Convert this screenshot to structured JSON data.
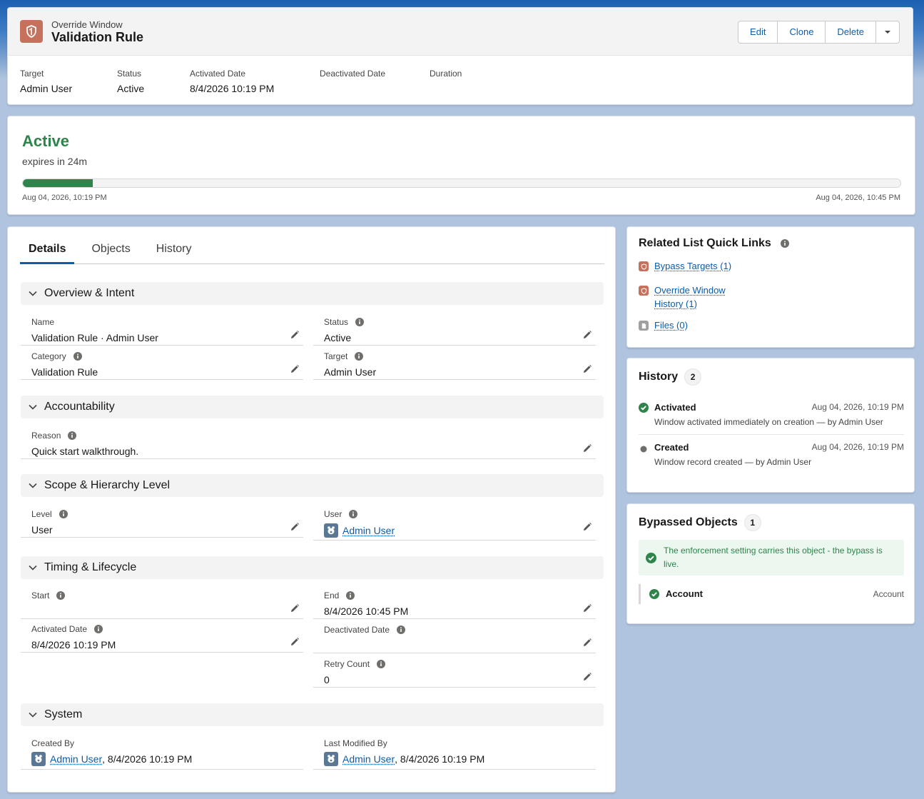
{
  "header": {
    "object_type": "Override Window",
    "title": "Validation Rule",
    "buttons": {
      "edit": "Edit",
      "clone": "Clone",
      "delete": "Delete"
    },
    "highlights": [
      {
        "label": "Target",
        "value": "Admin User"
      },
      {
        "label": "Status",
        "value": "Active"
      },
      {
        "label": "Activated Date",
        "value": "8/4/2026 10:19 PM"
      },
      {
        "label": "Deactivated Date",
        "value": ""
      },
      {
        "label": "Duration",
        "value": ""
      }
    ]
  },
  "status_card": {
    "title": "Active",
    "subtitle": "expires in 24m",
    "progress": 0.08,
    "start_label": "Aug 04, 2026, 10:19 PM",
    "end_label": "Aug 04, 2026, 10:45 PM"
  },
  "tabs": [
    {
      "label": "Details",
      "active": true
    },
    {
      "label": "Objects",
      "active": false
    },
    {
      "label": "History",
      "active": false
    }
  ],
  "sections": {
    "overview": {
      "title": "Overview & Intent",
      "name_label": "Name",
      "name_value": "Validation Rule · Admin User",
      "status_label": "Status",
      "status_value": "Active",
      "category_label": "Category",
      "category_value": "Validation Rule",
      "target_label": "Target",
      "target_value": "Admin User"
    },
    "accountability": {
      "title": "Accountability",
      "reason_label": "Reason",
      "reason_value": "Quick start walkthrough."
    },
    "scope": {
      "title": "Scope & Hierarchy Level",
      "level_label": "Level",
      "level_value": "User",
      "user_label": "User",
      "user_value": "Admin User"
    },
    "timing": {
      "title": "Timing & Lifecycle",
      "start_label": "Start",
      "start_value": "",
      "end_label": "End",
      "end_value": "8/4/2026 10:45 PM",
      "activated_label": "Activated Date",
      "activated_value": "8/4/2026 10:19 PM",
      "deactivated_label": "Deactivated Date",
      "deactivated_value": "",
      "retry_label": "Retry Count",
      "retry_value": "0"
    },
    "system": {
      "title": "System",
      "created_label": "Created By",
      "created_user": "Admin User",
      "created_date": ", 8/4/2026 10:19 PM",
      "modified_label": "Last Modified By",
      "modified_user": "Admin User",
      "modified_date": ", 8/4/2026 10:19 PM"
    }
  },
  "quick_links": {
    "title": "Related List Quick Links",
    "items": [
      {
        "label": "Bypass Targets (1)",
        "icon": "shield-icon"
      },
      {
        "label_line1": "Override Window",
        "label_line2": "History (1)",
        "icon": "shield-icon"
      },
      {
        "label": "Files (0)",
        "icon": "file-icon"
      }
    ]
  },
  "history": {
    "title": "History",
    "count": "2",
    "items": [
      {
        "name": "Activated",
        "date": "Aug 04, 2026, 10:19 PM",
        "desc": "Window activated immediately on creation — by Admin User",
        "icon": "check-circle-icon"
      },
      {
        "name": "Created",
        "date": "Aug 04, 2026, 10:19 PM",
        "desc": "Window record created — by Admin User",
        "icon": "dot-icon"
      }
    ]
  },
  "bypassed": {
    "title": "Bypassed Objects",
    "count": "1",
    "banner": "The enforcement setting carries this object - the bypass is live.",
    "object_name": "Account",
    "object_type": "Account"
  },
  "colors": {
    "accent": "#0b5cab",
    "success": "#2e844a",
    "object_icon": "#c6715b",
    "background": "#b0c4df"
  }
}
